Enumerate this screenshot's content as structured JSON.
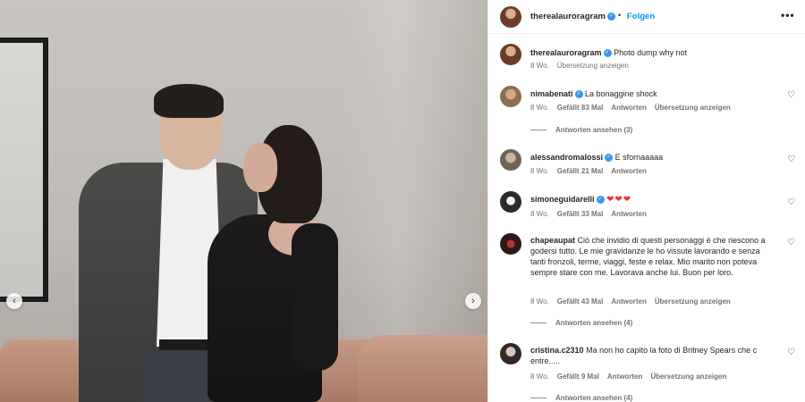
{
  "post": {
    "username": "therealauroragram",
    "separator": "•",
    "follow_label": "Folgen",
    "more_label": "•••",
    "caption": "Photo dump why not",
    "caption_time": "8 Wo.",
    "caption_translate": "Übersetzung anzeigen"
  },
  "media": {
    "prev_icon": "chevron-left-icon",
    "next_icon": "chevron-right-icon",
    "prev_glyph": "‹",
    "next_glyph": "›"
  },
  "comments": [
    {
      "user": "nimabenati",
      "verified": true,
      "text": "La bonaggine shock",
      "time": "8 Wo.",
      "likes": "Gefällt 83 Mal",
      "reply": "Antworten",
      "translate": "Übersetzung anzeigen",
      "replies": "Antworten ansehen (3)"
    },
    {
      "user": "alessandromalossi",
      "verified": true,
      "text": "E sfornaaaaa",
      "time": "8 Wo.",
      "likes": "Gefällt 21 Mal",
      "reply": "Antworten"
    },
    {
      "user": "simoneguidarelli",
      "verified": true,
      "text": "❤❤❤",
      "time": "8 Wo.",
      "likes": "Gefällt 33 Mal",
      "reply": "Antworten"
    },
    {
      "user": "chapeaupat",
      "verified": false,
      "text": "Ciò che invidio di questi personaggi è che riescono a godersi tutto. Le mie gravidanze le ho vissute lavorando e senza tanti fronzoli, terme, viaggi, feste e relax. Mio marito non poteva sempre stare con me. Lavorava anche lui. Buon per loro.",
      "time": "8 Wo.",
      "likes": "Gefällt 43 Mal",
      "reply": "Antworten",
      "translate": "Übersetzung anzeigen",
      "replies": "Antworten ansehen (4)"
    },
    {
      "user": "cristina.c2310",
      "verified": false,
      "text": "Ma non ho capito la foto di Britney Spears che c entre.....",
      "time": "8 Wo.",
      "likes": "Gefällt 9 Mal",
      "reply": "Antworten",
      "translate": "Übersetzung anzeigen",
      "replies": "Antworten ansehen (4)"
    }
  ],
  "icons": {
    "heart": "♡",
    "verified": "✓"
  },
  "colors": {
    "accent_blue": "#0095f6",
    "verified_blue": "#3897f0",
    "meta_gray": "#737373"
  }
}
